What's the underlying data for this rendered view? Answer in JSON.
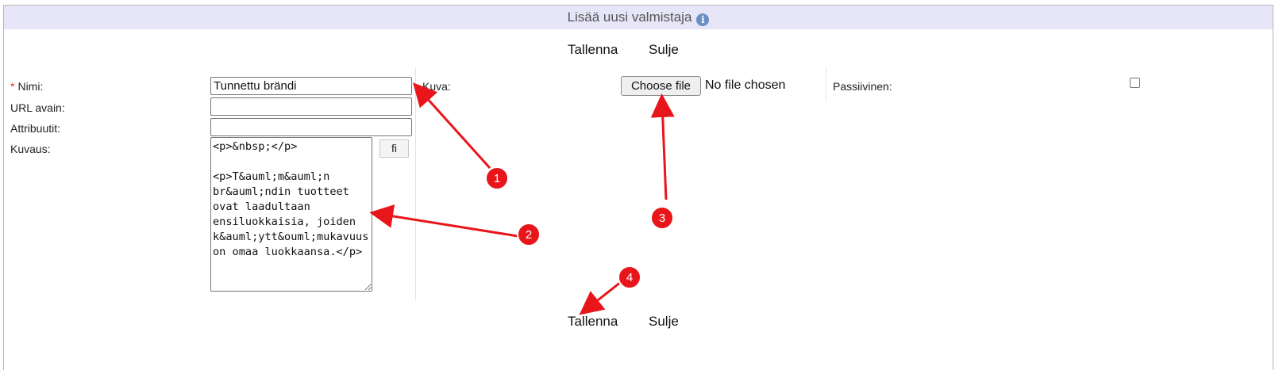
{
  "dialog": {
    "title": "Lisää uusi valmistaja",
    "info_icon": "info-icon",
    "info_glyph": "i"
  },
  "top_actions": {
    "save_label": "Tallenna",
    "close_label": "Sulje"
  },
  "bottom_actions": {
    "save_label": "Tallenna",
    "close_label": "Sulje"
  },
  "form": {
    "required_mark": "*",
    "name": {
      "label": "Nimi:",
      "value": "Tunnettu brändi"
    },
    "url_key": {
      "label": "URL avain:",
      "value": ""
    },
    "attributes": {
      "label": "Attribuutit:",
      "value": ""
    },
    "description": {
      "label": "Kuvaus:",
      "value": "<p>&nbsp;</p>\n\n<p>T&auml;m&auml;n br&auml;ndin tuotteet ovat laadultaan ensiluokkaisia, joiden k&auml;ytt&ouml;mukavuus on omaa luokkaansa.</p>",
      "language_button": "fi"
    },
    "image": {
      "label": "Kuva:",
      "button_label": "Choose file",
      "status": "No file chosen"
    },
    "passive": {
      "label": "Passiivinen:",
      "checked": false
    }
  },
  "annotations": {
    "color": "#e8161b",
    "markers": [
      "1",
      "2",
      "3",
      "4"
    ]
  }
}
